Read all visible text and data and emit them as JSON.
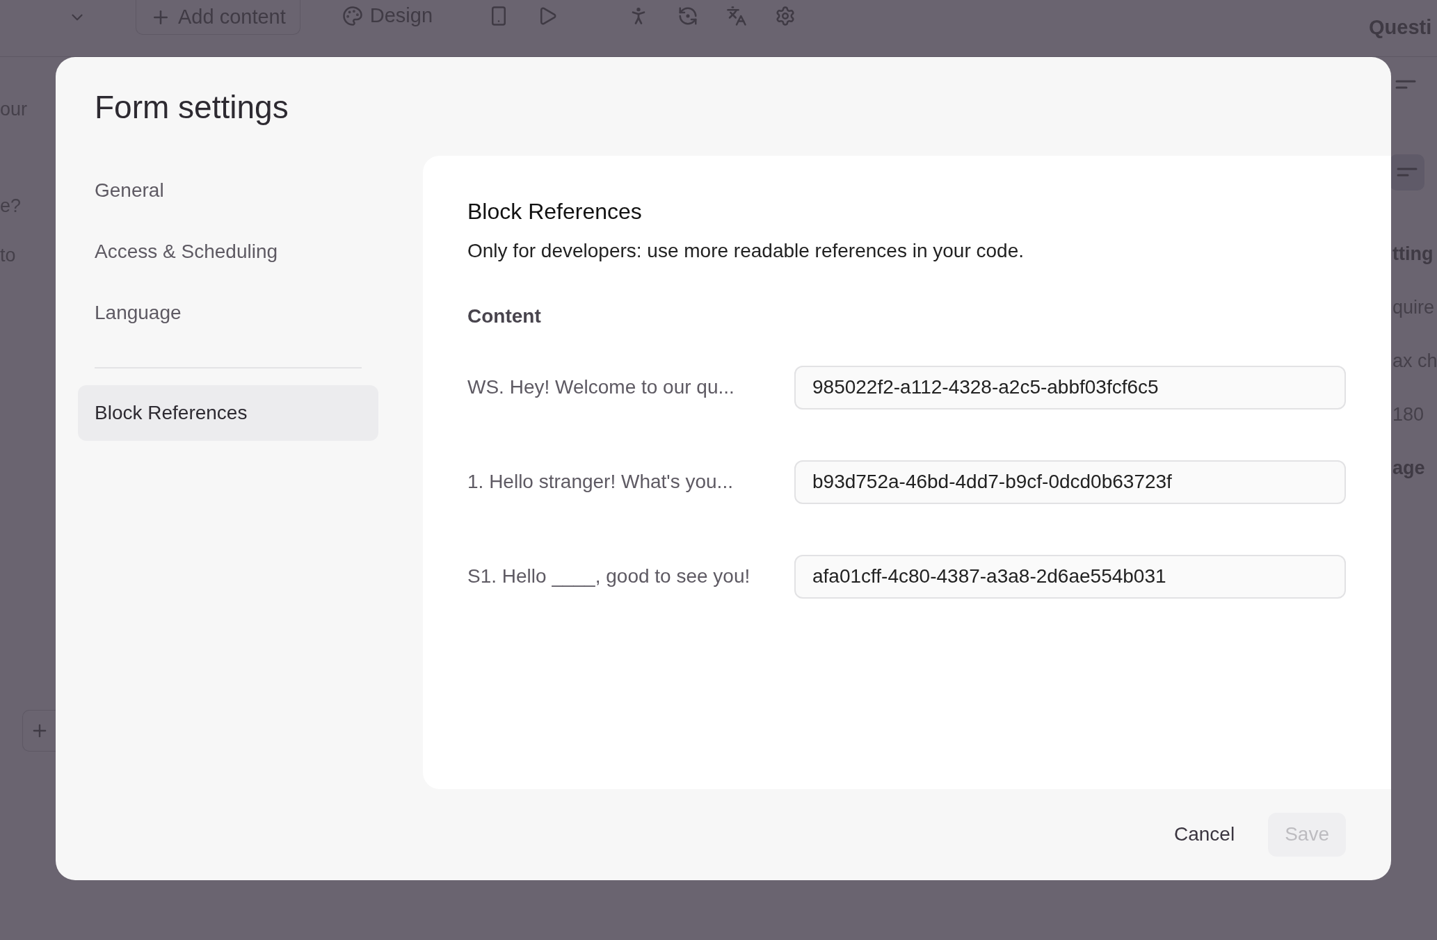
{
  "background": {
    "toolbar": {
      "add_button": "Add content",
      "design_button": "Design"
    },
    "right_header": "Questi",
    "left_texts": [
      "our",
      "e?",
      "to"
    ],
    "right_texts": [
      {
        "text": "tting",
        "bold": true
      },
      {
        "text": "quire",
        "bold": false
      },
      {
        "text": "ax ch",
        "bold": false
      },
      {
        "text": "180",
        "bold": false
      },
      {
        "text": "age",
        "bold": true
      }
    ]
  },
  "dialog": {
    "title": "Form settings",
    "sidebar": {
      "sections": [
        [
          {
            "label": "General",
            "selected": false
          },
          {
            "label": "Access & Scheduling",
            "selected": false
          },
          {
            "label": "Language",
            "selected": false
          }
        ],
        [
          {
            "label": "Block References",
            "selected": true
          }
        ]
      ]
    },
    "panel": {
      "heading": "Block References",
      "description": "Only for developers: use more readable references in your code.",
      "group_label": "Content",
      "rows": [
        {
          "label": "WS. Hey! Welcome to our qu...",
          "value": "985022f2-a112-4328-a2c5-abbf03fcf6c5"
        },
        {
          "label": "1. Hello stranger! What's you...",
          "value": "b93d752a-46bd-4dd7-b9cf-0dcd0b63723f"
        },
        {
          "label": "S1. Hello ____, good to see you!",
          "value": "afa01cff-4c80-4387-a3a8-2d6ae554b031"
        }
      ]
    },
    "buttons": [
      {
        "label": "Cancel",
        "kind": "text",
        "disabled": false
      },
      {
        "label": "Save",
        "kind": "primary",
        "disabled": true
      }
    ]
  }
}
